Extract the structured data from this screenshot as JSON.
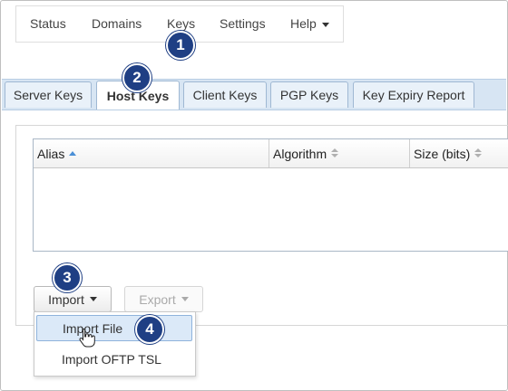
{
  "nav": {
    "items": [
      "Status",
      "Domains",
      "Keys",
      "Settings",
      "Help"
    ]
  },
  "tabs": [
    "Server Keys",
    "Host Keys",
    "Client Keys",
    "PGP Keys",
    "Key Expiry Report"
  ],
  "active_tab": "Host Keys",
  "table": {
    "columns": [
      "Alias",
      "Algorithm",
      "Size (bits)"
    ],
    "sorted_column": "Alias",
    "rows": []
  },
  "buttons": {
    "import": "Import",
    "export": "Export"
  },
  "import_menu": {
    "items": [
      "Import File",
      "Import OFTP TSL"
    ],
    "hovered": "Import File"
  },
  "callouts": [
    "1",
    "2",
    "3",
    "4"
  ],
  "colors": {
    "callout": "#1f3f84",
    "tab_bar": "#d7e5f3",
    "menu_hover": "#dbe9f8",
    "sort_active": "#4a8fd6"
  }
}
